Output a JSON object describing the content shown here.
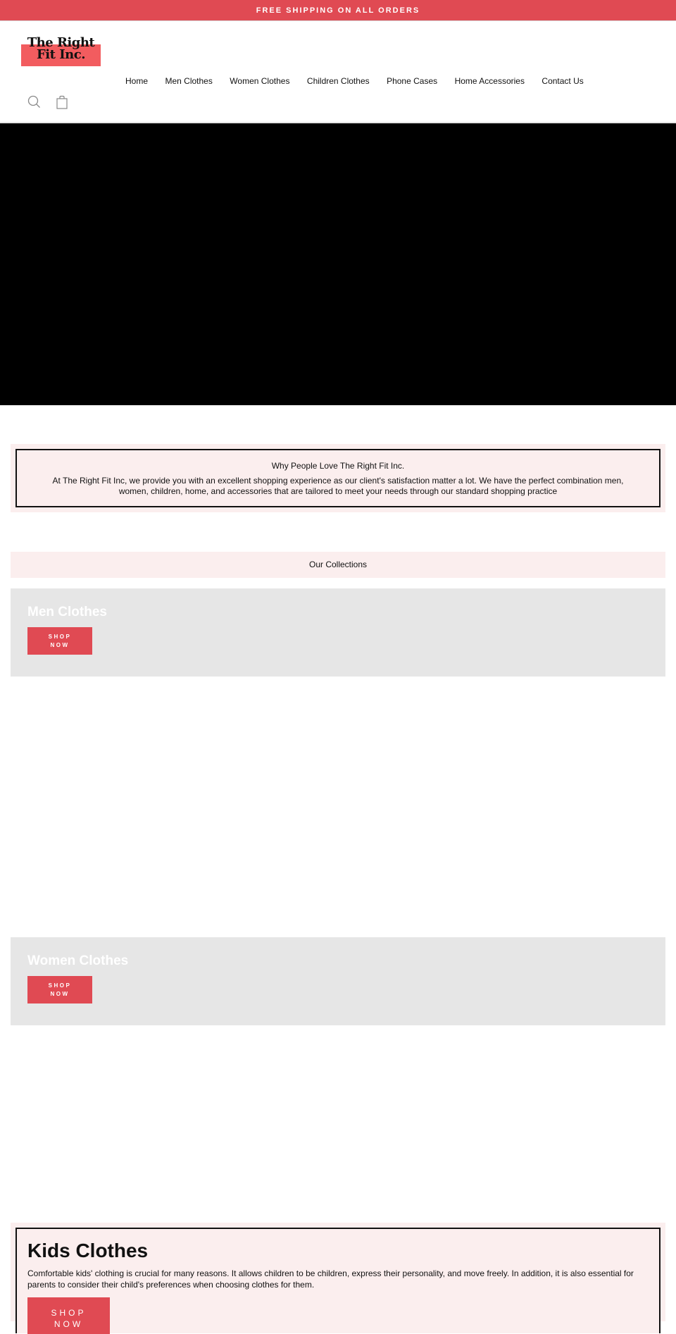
{
  "announcement": {
    "text": "FREE SHIPPING ON ALL ORDERS"
  },
  "header": {
    "logo_text": "The Right Fit Inc.",
    "nav": [
      {
        "label": "Home"
      },
      {
        "label": "Men Clothes"
      },
      {
        "label": "Women Clothes"
      },
      {
        "label": "Children Clothes"
      },
      {
        "label": "Phone Cases"
      },
      {
        "label": "Home Accessories"
      },
      {
        "label": "Contact Us"
      }
    ],
    "icons": {
      "search": "search-icon",
      "cart": "shopping-bag-icon"
    }
  },
  "why": {
    "title": "Why People Love The Right Fit Inc.",
    "text": "At The Right Fit Inc, we provide you with an excellent shopping experience as our client's satisfaction matter a lot. We have the perfect combination men, women, children, home, and accessories that are tailored to meet your needs through our standard shopping practice"
  },
  "collections": {
    "heading": "Our Collections",
    "items": [
      {
        "title": "Men Clothes",
        "button": "SHOP NOW"
      },
      {
        "title": "Women Clothes",
        "button": "SHOP NOW"
      }
    ]
  },
  "kids": {
    "title": "Kids Clothes",
    "text": "Comfortable kids' clothing is crucial for many reasons. It allows children to be children, express their personality, and move freely. In addition, it is also essential for parents to consider their child's preferences when choosing clothes for them.",
    "button": "SHOP NOW"
  },
  "colors": {
    "accent": "#e04a53",
    "logo_bar": "#f25c5f",
    "section_bg": "#fbeeee",
    "card_bg": "#e6e6e6"
  }
}
